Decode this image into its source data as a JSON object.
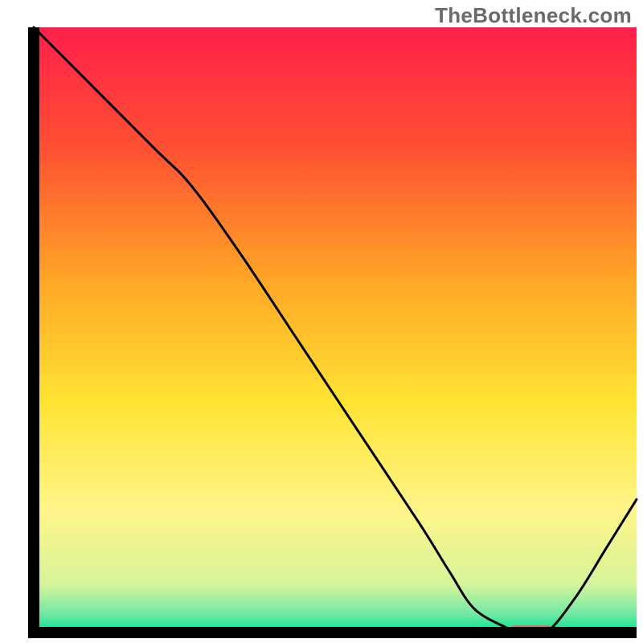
{
  "watermark": "TheBottleneck.com",
  "chart_data": {
    "type": "line",
    "title": "",
    "xlabel": "",
    "ylabel": "",
    "xlim": [
      0,
      100
    ],
    "ylim": [
      0,
      100
    ],
    "axes": {
      "left": true,
      "bottom": true,
      "right": false,
      "top": false,
      "ticks": false,
      "grid": false
    },
    "background_gradient": {
      "direction": "top-to-bottom",
      "stops": [
        {
          "pos": 0.0,
          "color": "#ff1f4b"
        },
        {
          "pos": 0.2,
          "color": "#ff5032"
        },
        {
          "pos": 0.42,
          "color": "#ffa726"
        },
        {
          "pos": 0.62,
          "color": "#ffe433"
        },
        {
          "pos": 0.8,
          "color": "#fff58a"
        },
        {
          "pos": 0.92,
          "color": "#d6f59a"
        },
        {
          "pos": 0.97,
          "color": "#6fe8a4"
        },
        {
          "pos": 1.0,
          "color": "#00e58f"
        }
      ]
    },
    "series": [
      {
        "name": "curve",
        "color": "#000000",
        "x": [
          0,
          8,
          20,
          26,
          34,
          44,
          54,
          64,
          69,
          73,
          78,
          81,
          85,
          90,
          95,
          100
        ],
        "y": [
          100,
          92,
          80,
          74,
          63,
          48,
          33,
          18,
          10,
          4,
          1,
          0,
          0,
          6,
          14,
          22
        ]
      }
    ],
    "marker": {
      "name": "optimal-region",
      "color": "#e46a6a",
      "x_start": 79,
      "x_end": 86,
      "y": 0.4,
      "thickness": 1.6
    }
  }
}
